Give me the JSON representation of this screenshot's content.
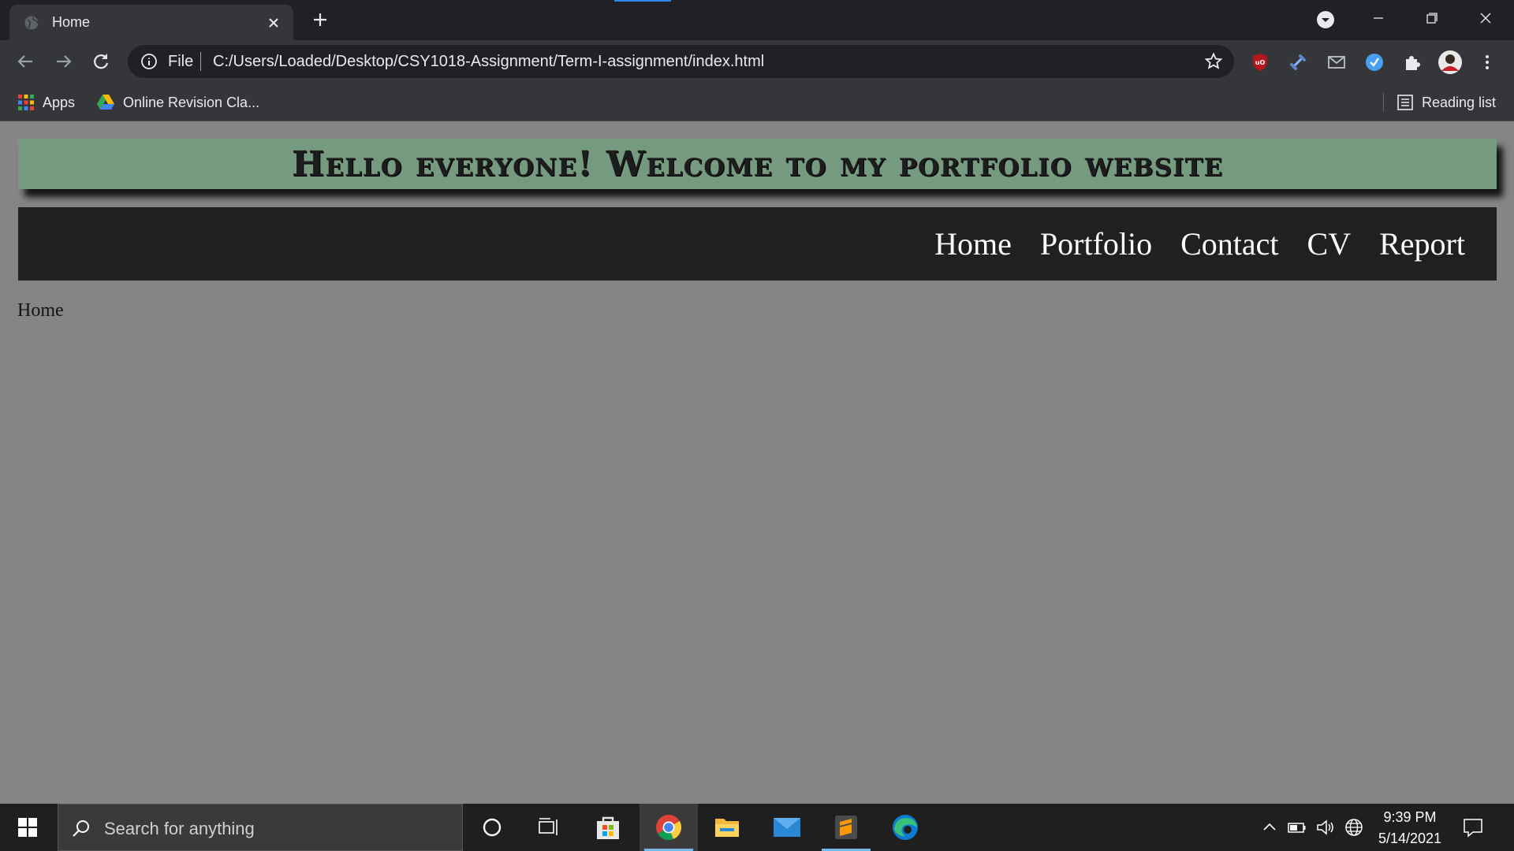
{
  "browser": {
    "tab_title": "Home",
    "url_scheme": "File",
    "url": "C:/Users/Loaded/Desktop/CSY1018-Assignment/Term-I-assignment/index.html",
    "bookmarks": {
      "apps": "Apps",
      "drive": "Online Revision Cla...",
      "reading_list": "Reading list"
    }
  },
  "page": {
    "banner_title": "Hello everyone! Welcome to my portfolio website",
    "nav": [
      "Home",
      "Portfolio",
      "Contact",
      "CV",
      "Report"
    ],
    "breadcrumb": "Home"
  },
  "taskbar": {
    "search_placeholder": "Search for anything",
    "time": "9:39 PM",
    "date": "5/14/2021"
  },
  "colors": {
    "banner": "#759a80",
    "nav_bg": "#202020",
    "page_bg": "#858585",
    "accent": "#2b88e8"
  }
}
